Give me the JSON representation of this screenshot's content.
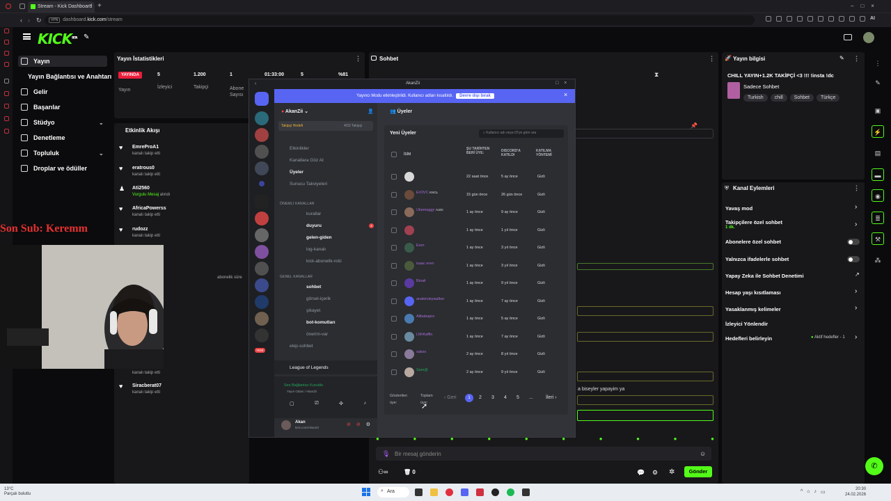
{
  "browser": {
    "tab_title": "Stream - Kick Dashboard",
    "url_prefix": "dashboard.",
    "url_domain": "kick.com",
    "url_path": "/stream",
    "vpn_label": "VPN",
    "ai_label": "AI"
  },
  "header": {
    "logo": "KICK",
    "logo_badge": "BETA"
  },
  "nav": {
    "items": [
      {
        "label": "Yayın"
      },
      {
        "label": "Yayın Bağlantısı ve Anahtarı"
      },
      {
        "label": "Gelir"
      },
      {
        "label": "Başarılar"
      },
      {
        "label": "Stüdyo"
      },
      {
        "label": "Denetleme"
      },
      {
        "label": "Topluluk"
      },
      {
        "label": "Droplar ve ödüller"
      }
    ]
  },
  "stats": {
    "title": "Yayın İstatistikleri",
    "live_badge": "YAYINDA",
    "live_label": "Yayın",
    "viewers_value": "5",
    "viewers_label": "İzleyici",
    "followers_value": "1.200",
    "followers_label": "Takipçi",
    "subs_value": "1",
    "subs_label": "Abone",
    "subs_label2": "Sayısı",
    "duration_value": "01:33:00",
    "v5_value": "5",
    "pct_value": "%81"
  },
  "activity": {
    "title": "Etkinlik Akışı",
    "items": [
      {
        "name": "EmreProA1",
        "text": "kanalı takip etti"
      },
      {
        "name": "eratrous0",
        "text": "kanalı takip etti"
      },
      {
        "name": "Ati2560",
        "text_hl": "Vurgulu Mesaj",
        "text": " alındı"
      },
      {
        "name": "AfricaPowerss",
        "text": "kanalı takip etti"
      },
      {
        "name": "rudozz",
        "text": "kanalı takip etti"
      },
      {
        "name": "",
        "text": "kanalı takip etti"
      },
      {
        "name": "Siracberat07",
        "text": "kanalı takip etti"
      }
    ],
    "partial": "abonelik süre"
  },
  "overlay": {
    "sonsub": "Son Sub: Keremm"
  },
  "chat": {
    "title": "Sohbet",
    "placeholder": "Bir mesaj gönderin",
    "send": "Gönder",
    "count": "0",
    "snippet": "a biseyler yapayim ya"
  },
  "discord": {
    "window_title": "AkanZii",
    "banner": "Yayıncı Modu etkinleştirildi. Kullanıcı adları kısaltıldı.",
    "banner_btn": "Devre dışı bırak",
    "server_name": "AkanZii",
    "goal_label": "Takipçi Hedefi",
    "goal_value": "4/33 Takipçi",
    "top_channels": [
      "Etkinlikler",
      "Kanallara Göz At",
      "Üyeler",
      "Sunucu Takviyeleri"
    ],
    "cat1": "ÖNEMLİ KANALLAR",
    "cat1_channels": [
      "kurallar",
      "duyuru",
      "gelen-giden",
      "log-kanalı",
      "kick-abonelik-rolü"
    ],
    "cat2": "GENEL KANALLAR",
    "cat2_channels": [
      "sohbet",
      "görsel-içerik",
      "şikayet",
      "bot-komutları",
      "önerim-var",
      "ekip-sohbet"
    ],
    "mention_badge": "4",
    "new_badge": "YENİ",
    "activity_game": "League of Legends",
    "voice_status": "Ses Bağlantısı Kuruldu",
    "voice_sub": "Yayın Odası / AkanZii",
    "user_name": "Akan",
    "user_sub": "kick.com/AkanZii",
    "pane_title": "Üyeler",
    "section_title": "Yeni Üyeler",
    "search_placeholder": "Kullanıcı adı veya ID'ye göre ara",
    "col_name": "İSİM",
    "col_joined": "ŞU TARİHTEN BERİ ÜYE:",
    "col_discord": "DISCORD'A KATILDI",
    "col_method": "KATILMA YÖNTEMİ",
    "rows": [
      {
        "name": "",
        "tag": "",
        "since": "22 saat önce",
        "discord": "5 ay önce",
        "method": "Gizli"
      },
      {
        "name": "ErOVC",
        "tag": "KNGL",
        "since": "15 gün önce",
        "discord": "26 gün önce",
        "method": "Gizli"
      },
      {
        "name": "Ukemeggy",
        "tag": "AUDI",
        "since": "1 ay önce",
        "discord": "9 ay önce",
        "method": "Gizli"
      },
      {
        "name": "",
        "tag": "",
        "since": "1 ay önce",
        "discord": "1 yıl önce",
        "method": "Gizli"
      },
      {
        "name": "Eren",
        "tag": "",
        "since": "1 ay önce",
        "discord": "3 yıl önce",
        "method": "Gizli"
      },
      {
        "name": "isaac eren",
        "tag": "",
        "since": "1 ay önce",
        "discord": "3 yıl önce",
        "method": "Gizli"
      },
      {
        "name": "Binali",
        "tag": "",
        "since": "1 ay önce",
        "discord": "9 yıl önce",
        "method": "Gizli"
      },
      {
        "name": "anakinskywalker",
        "tag": "",
        "since": "1 ay önce",
        "discord": "7 ay önce",
        "method": "Gizli"
      },
      {
        "name": "Alibabapro",
        "tag": "",
        "since": "1 ay önce",
        "discord": "5 ay önce",
        "method": "Gizli"
      },
      {
        "name": "LMrKaffin",
        "tag": "",
        "since": "1 ay önce",
        "discord": "7 ay önce",
        "method": "Gizli"
      },
      {
        "name": "sakso",
        "tag": "",
        "since": "2 ay önce",
        "discord": "8 yıl önce",
        "method": "Gizli"
      },
      {
        "name": "Sam@",
        "tag": "",
        "since": "2 ay önce",
        "discord": "9 yıl önce",
        "method": "Gizli"
      }
    ],
    "shown_label": "Gösterilen üye:",
    "total_label": "Toplam üye:",
    "prev": "Geri",
    "next": "İleri",
    "pages": [
      "1",
      "2",
      "3",
      "4",
      "5",
      "..."
    ]
  },
  "info": {
    "title": "Yayın bilgisi",
    "stream_title": "CHILL YAYIN+1.2K TAKİPÇİ <3 !!! !insta !dc",
    "category": "Sadece Sohbet",
    "tags": [
      "Turkish",
      "chill",
      "Sohbet",
      "Türkçe"
    ]
  },
  "actions": {
    "title": "Kanal Eylemleri",
    "items": [
      {
        "label": "Yavaş mod",
        "kind": "arrow"
      },
      {
        "label": "Takipçilere özel sohbet",
        "sub": "1 dk.",
        "kind": "arrow"
      },
      {
        "label": "Abonelere özel sohbet",
        "kind": "toggle"
      },
      {
        "label": "Yalnızca ifadelerle sohbet",
        "kind": "toggle"
      },
      {
        "label": "Yapay Zeka ile Sohbet Denetimi",
        "kind": "ext"
      },
      {
        "label": "Hesap yaşı kısıtlaması",
        "kind": "arrow"
      },
      {
        "label": "Yasaklanmış kelimeler",
        "kind": "arrow"
      },
      {
        "label": "İzleyici Yönlendir",
        "kind": "none"
      },
      {
        "label": "Hedefleri belirleyin",
        "kind": "goal",
        "goal": "Aktif hedefler - 1"
      }
    ]
  },
  "taskbar": {
    "weather_temp": "13°C",
    "weather_desc": "Parçalı bulutlu",
    "search": "Ara",
    "time": "20:30",
    "date": "24.02.2026"
  },
  "colors": {
    "kick_green": "#53fc18",
    "discord_blurple": "#5865f2",
    "live_red": "#e91e3a"
  }
}
